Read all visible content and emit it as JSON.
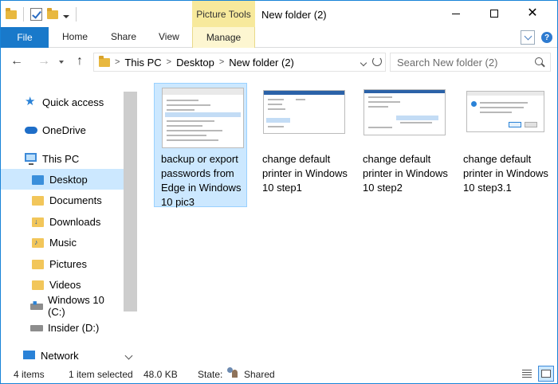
{
  "window": {
    "title": "New folder (2)",
    "context_tab_group": "Picture Tools"
  },
  "ribbon": {
    "file": "File",
    "tabs": [
      "Home",
      "Share",
      "View"
    ],
    "manage": "Manage"
  },
  "address": {
    "crumbs": [
      "This PC",
      "Desktop",
      "New folder (2)"
    ],
    "search_placeholder": "Search New folder (2)"
  },
  "nav": {
    "items": [
      {
        "label": "Quick access",
        "icon": "star-icon"
      },
      {
        "label": "OneDrive",
        "icon": "cloud-icon"
      },
      {
        "label": "This PC",
        "icon": "computer-icon"
      },
      {
        "label": "Desktop",
        "icon": "desktop-folder-icon",
        "selected": true
      },
      {
        "label": "Documents",
        "icon": "documents-folder-icon"
      },
      {
        "label": "Downloads",
        "icon": "downloads-folder-icon"
      },
      {
        "label": "Music",
        "icon": "music-folder-icon"
      },
      {
        "label": "Pictures",
        "icon": "pictures-folder-icon"
      },
      {
        "label": "Videos",
        "icon": "videos-folder-icon"
      },
      {
        "label": "Windows 10 (C:)",
        "icon": "windows-drive-icon"
      },
      {
        "label": "Insider (D:)",
        "icon": "drive-icon"
      },
      {
        "label": "Network",
        "icon": "network-icon"
      }
    ]
  },
  "files": [
    {
      "name": "backup or export passwords from Edge in Windows 10 pic3",
      "selected": true
    },
    {
      "name": "change default printer in Windows 10 step1",
      "selected": false
    },
    {
      "name": "change default printer in Windows 10 step2",
      "selected": false
    },
    {
      "name": "change default printer in Windows 10 step3.1",
      "selected": false
    }
  ],
  "status": {
    "item_count": "4 items",
    "selection": "1 item selected",
    "size": "48.0 KB",
    "state_label": "State:",
    "state_value": "Shared"
  },
  "colors": {
    "accent": "#1979ca",
    "selection": "#cce8ff",
    "context_tab": "#f7e99c"
  }
}
